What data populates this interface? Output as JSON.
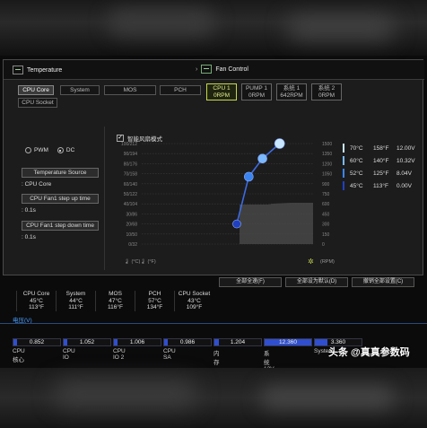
{
  "temperature": {
    "title": "Temperature",
    "sensors": [
      "CPU Core",
      "System",
      "MOS",
      "PCH",
      "CPU Socket"
    ],
    "active_sensor": "CPU Core"
  },
  "fan_control": {
    "title": "Fan Control",
    "fans": [
      {
        "name": "CPU 1",
        "rpm": "0RPM",
        "active": true
      },
      {
        "name": "PUMP 1",
        "rpm": "0RPM",
        "active": false
      },
      {
        "name": "系统 1",
        "rpm": "642RPM",
        "active": false
      },
      {
        "name": "系统 2",
        "rpm": "0RPM",
        "active": false
      }
    ]
  },
  "mode": {
    "pwm_label": "PWM",
    "dc_label": "DC",
    "selected": "DC"
  },
  "left_panel": {
    "temp_source_btn": "Temperature Source",
    "temp_source_val": ": CPU Core",
    "step_up_btn": "CPU Fan1 step up time",
    "step_up_val": ": 0.1s",
    "step_down_btn": "CPU Fan1 step down time",
    "step_down_val": ": 0.1s"
  },
  "smart_mode": {
    "label": "智能风扇模式",
    "checked": true
  },
  "chart_data": {
    "type": "line",
    "x_unit": "°C",
    "y_unit": "RPM",
    "left_axis_ticks": [
      "100/212",
      "90/194",
      "80/176",
      "70/158",
      "60/140",
      "50/122",
      "40/104",
      "30/86",
      "20/68",
      "10/50",
      "0/32"
    ],
    "right_axis_ticks": [
      "1500",
      "1350",
      "1200",
      "1050",
      "900",
      "750",
      "600",
      "450",
      "300",
      "150",
      "0"
    ],
    "x_label_left": "(°C)",
    "x_label_right": "(°F)",
    "y_label_right": "(RPM)",
    "curve": [
      {
        "temp_c": 45,
        "value": 20
      },
      {
        "temp_c": 52,
        "value": 67
      },
      {
        "temp_c": 60,
        "value": 85
      },
      {
        "temp_c": 70,
        "value": 100
      }
    ],
    "ylim": [
      0,
      100
    ]
  },
  "legend": [
    {
      "c": "70°C",
      "f": "158°F",
      "v": "12.00V",
      "color": "#c8e6ff"
    },
    {
      "c": "60°C",
      "f": "140°F",
      "v": "10.32V",
      "color": "#7ab8ff"
    },
    {
      "c": "52°C",
      "f": "125°F",
      "v": "8.04V",
      "color": "#3a84f0"
    },
    {
      "c": "45°C",
      "f": "113°F",
      "v": "0.00V",
      "color": "#2040c0"
    }
  ],
  "actions": {
    "full_speed": "全部全速(F)",
    "set_default": "全部设为默认(D)",
    "cancel_all": "撤销全部设置(C)"
  },
  "readouts": [
    {
      "name": "CPU Core",
      "c": "45°C",
      "f": "113°F"
    },
    {
      "name": "System",
      "c": "44°C",
      "f": "111°F"
    },
    {
      "name": "MOS",
      "c": "47°C",
      "f": "116°F"
    },
    {
      "name": "PCH",
      "c": "57°C",
      "f": "134°F"
    },
    {
      "name": "CPU Socket",
      "c": "43°C",
      "f": "109°F"
    }
  ],
  "voltage": {
    "title": "电压(V)",
    "items": [
      {
        "label": "CPU核心",
        "value": "0.852"
      },
      {
        "label": "CPU IO",
        "value": "1.052"
      },
      {
        "label": "CPU IO 2",
        "value": "1.006"
      },
      {
        "label": "CPU SA",
        "value": "0.986"
      },
      {
        "label": "内存",
        "value": "1.204"
      },
      {
        "label": "系统 12V",
        "value": "12.360"
      },
      {
        "label": "System",
        "value": "3.360"
      }
    ]
  },
  "watermark": "头条 @真真参数码"
}
